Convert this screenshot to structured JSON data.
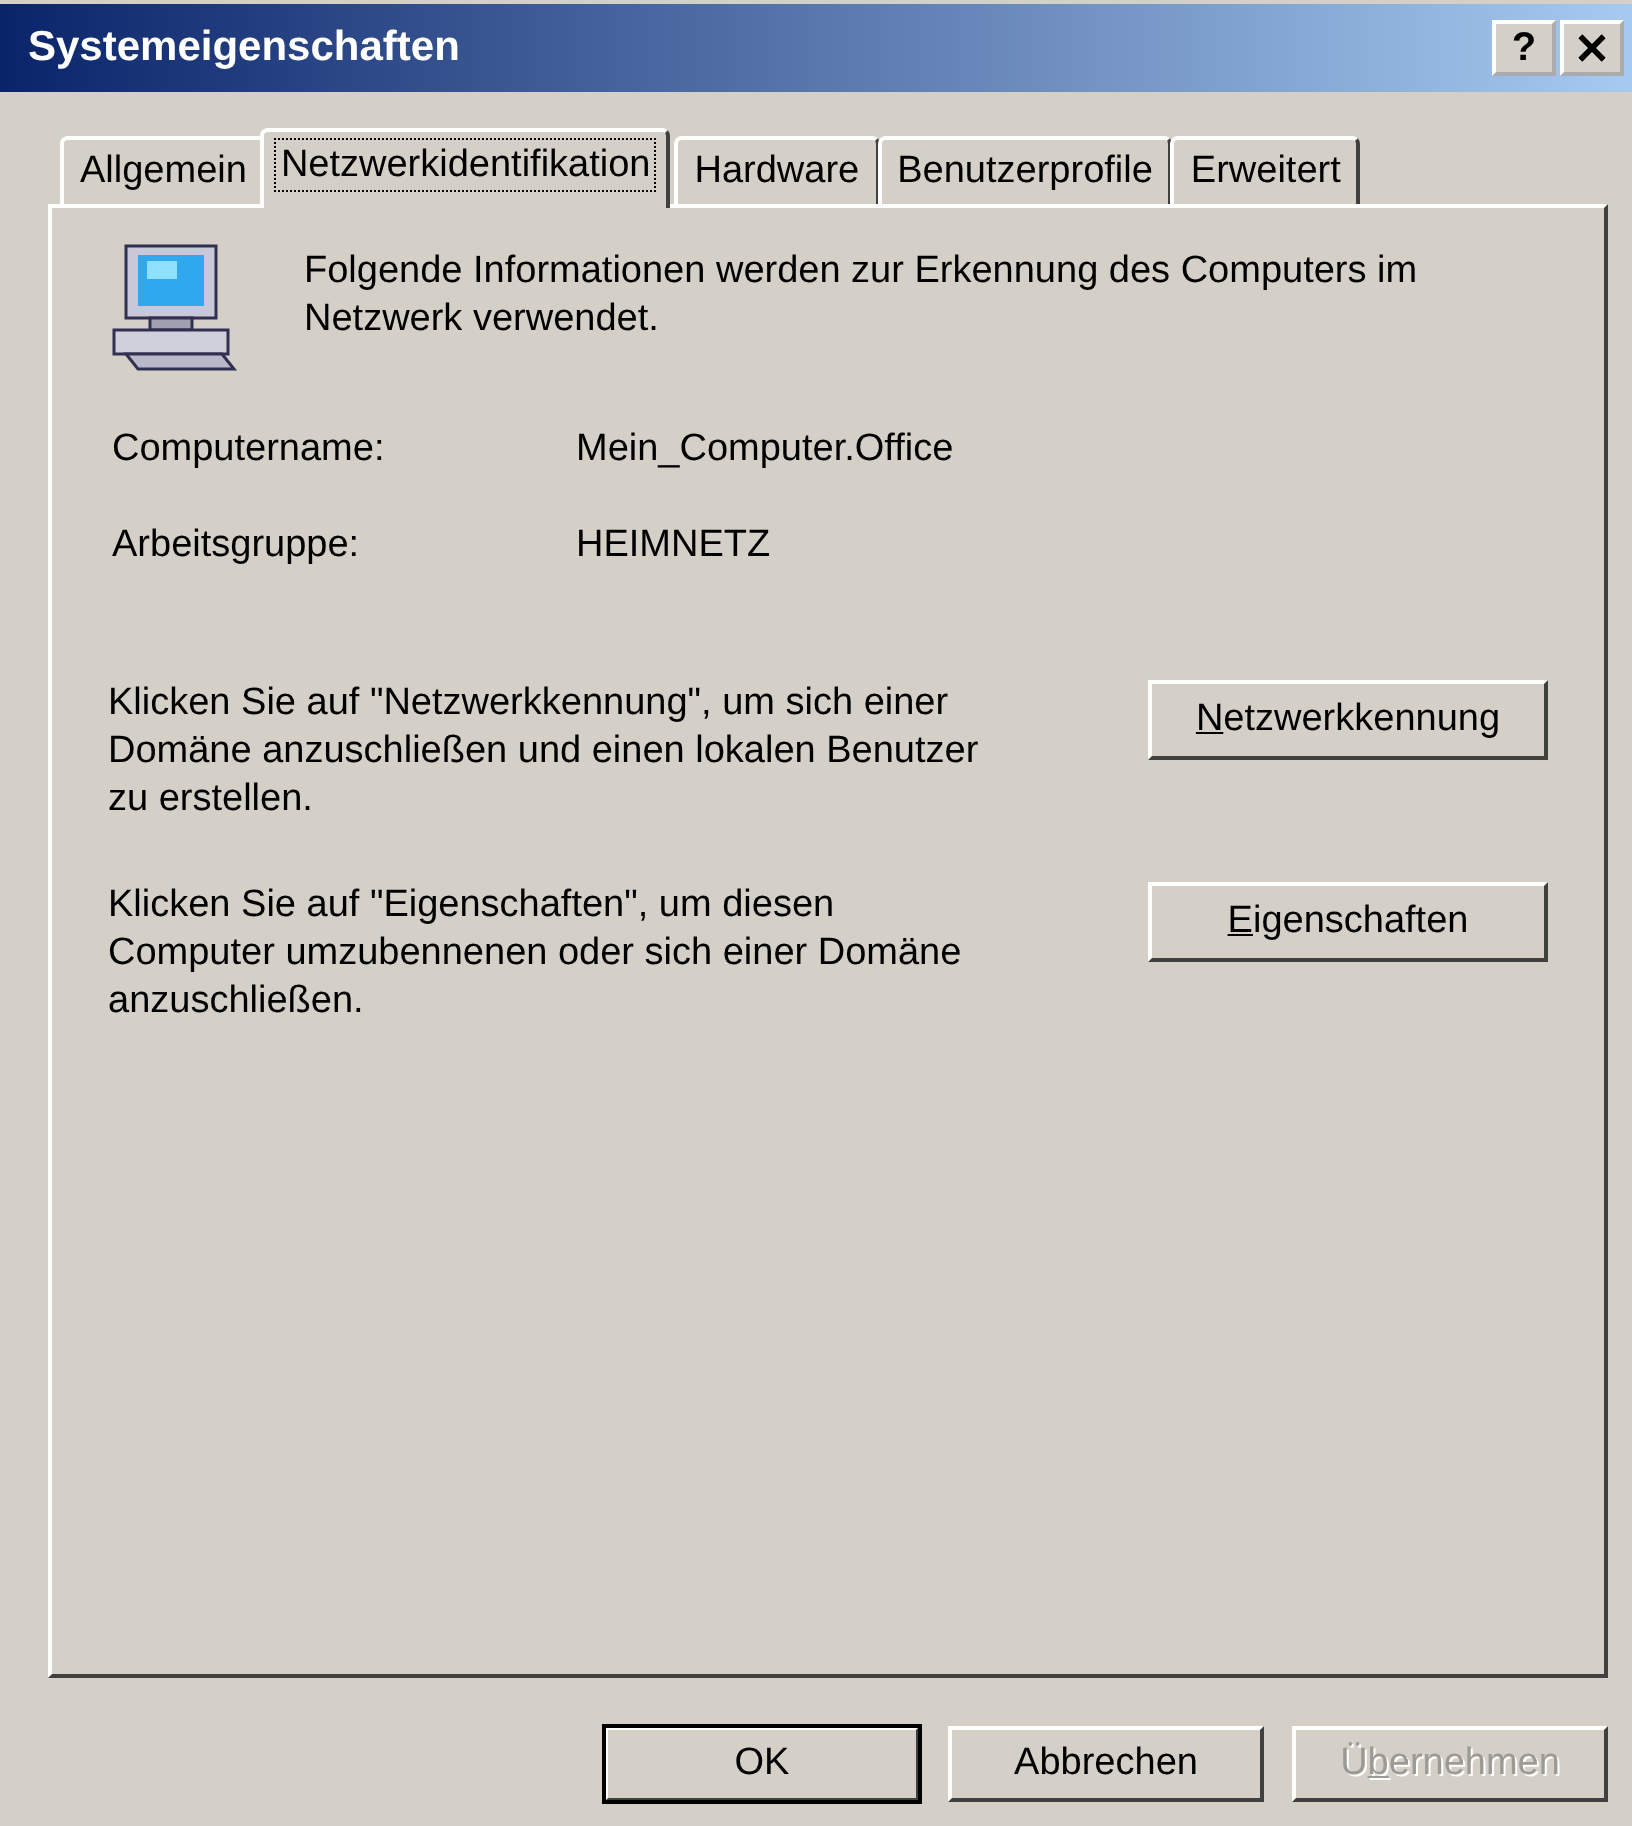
{
  "window": {
    "title": "Systemeigenschaften",
    "controls": [
      {
        "kind": "help",
        "label": "?"
      },
      {
        "kind": "close"
      }
    ]
  },
  "tabs": [
    {
      "label": "Allgemein",
      "selected": false
    },
    {
      "label": "Netzwerkidentifikation",
      "selected": true
    },
    {
      "label": "Hardware",
      "selected": false
    },
    {
      "label": "Benutzerprofile",
      "selected": false
    },
    {
      "label": "Erweitert",
      "selected": false
    }
  ],
  "intro": "Folgende Informationen werden zur Erkennung des Computers im Netzwerk verwendet.",
  "fields": [
    {
      "label": "Computername:",
      "value": "Mein_Computer.Office"
    },
    {
      "label": "Arbeitsgruppe:",
      "value": "HEIMNETZ"
    }
  ],
  "actions": [
    {
      "text": "Klicken Sie auf \"Netzwerkkennung\", um sich einer Domäne anzuschließen und einen lokalen Benutzer zu erstellen.",
      "button": {
        "label": [
          {
            "text": "N",
            "underline": true
          },
          {
            "text": "etzwerkkennung",
            "underline": false
          }
        ],
        "disabled": false
      }
    },
    {
      "text": "Klicken Sie auf \"Eigenschaften\", um diesen Computer umzubennenen oder sich einer Domäne anzuschließen.",
      "button": {
        "label": [
          {
            "text": "E",
            "underline": true
          },
          {
            "text": "igenschaften",
            "underline": false
          }
        ],
        "disabled": false
      }
    }
  ],
  "buttons": [
    {
      "label": [
        {
          "text": "OK",
          "underline": false
        }
      ],
      "default": true,
      "disabled": false
    },
    {
      "label": [
        {
          "text": "Abbrechen",
          "underline": false
        }
      ],
      "default": false,
      "disabled": false
    },
    {
      "label": [
        {
          "text": "Ü",
          "underline": false
        },
        {
          "text": "b",
          "underline": true
        },
        {
          "text": "ernehmen",
          "underline": false
        }
      ],
      "default": false,
      "disabled": true
    }
  ]
}
